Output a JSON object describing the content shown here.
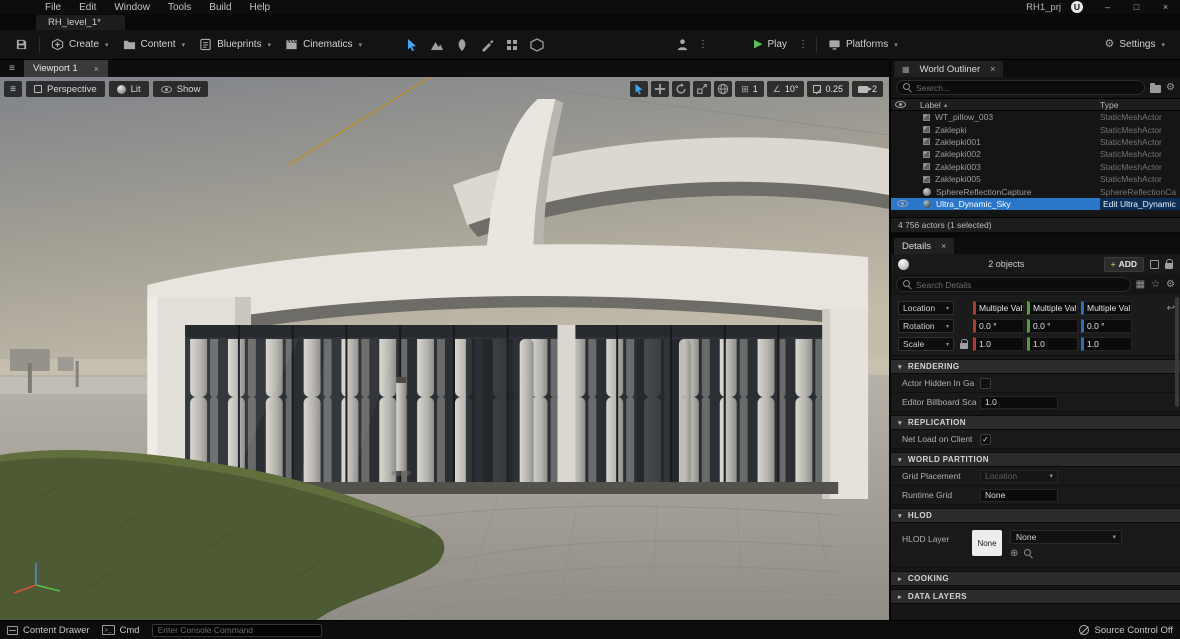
{
  "icons": {
    "menu": "≡",
    "caret_down": "▾",
    "caret_right": "▸",
    "sort_asc": "▴",
    "close": "×",
    "minimize": "–",
    "maximize": "□",
    "gear": "⚙",
    "play": "▶",
    "grid": "⊞",
    "view_grid": "▦",
    "angle": "∠",
    "reset": "↩",
    "check": "✓",
    "circle_plus": "⊕",
    "star": "☆",
    "kebab": "⋮",
    "plus": "+",
    "logo": "U",
    "cmd_prompt": "&gt;_"
  },
  "menubar": {
    "items": [
      "File",
      "Edit",
      "Window",
      "Tools",
      "Build",
      "Help"
    ],
    "project_name": "RH1_prj"
  },
  "tabbar": {
    "level_tab": "RH_level_1*"
  },
  "toolbar": {
    "create": "Create",
    "content": "Content",
    "blueprints": "Blueprints",
    "cinematics": "Cinematics",
    "play": "Play",
    "platforms": "Platforms",
    "settings": "Settings"
  },
  "viewport": {
    "tab": "Viewport 1",
    "perspective": "Perspective",
    "lit": "Lit",
    "show": "Show",
    "grid_snap": "1",
    "rotation_snap": "10°",
    "scale_snap": "0.25",
    "camera_speed": "2"
  },
  "outliner": {
    "title": "World Outliner",
    "search_placeholder": "Search...",
    "col_label": "Label",
    "col_type": "Type",
    "rows": [
      {
        "label": "WT_pillow_003",
        "type": "StaticMeshActor"
      },
      {
        "label": "Zaklepki",
        "type": "StaticMeshActor"
      },
      {
        "label": "Zaklepki001",
        "type": "StaticMeshActor"
      },
      {
        "label": "Zaklepki002",
        "type": "StaticMeshActor"
      },
      {
        "label": "Zaklepki003",
        "type": "StaticMeshActor"
      },
      {
        "label": "Zaklepki005",
        "type": "StaticMeshActor"
      },
      {
        "label": "SphereReflectionCapture",
        "type": "SphereReflectionCa"
      },
      {
        "label": "Ultra_Dynamic_Sky",
        "type": "Edit Ultra_Dynamic"
      }
    ],
    "footer": "4 756 actors (1 selected)"
  },
  "details": {
    "title": "Details",
    "objects_label": "2 objects",
    "add_label": "ADD",
    "search_placeholder": "Search Details",
    "transform": {
      "location_label": "Location",
      "rotation_label": "Rotation",
      "scale_label": "Scale",
      "location_values": [
        "Multiple Val",
        "Multiple Val",
        "Multiple Val"
      ],
      "rotation_values": [
        "0.0 °",
        "0.0 °",
        "0.0 °"
      ],
      "scale_values": [
        "1.0",
        "1.0",
        "1.0"
      ]
    },
    "sections": {
      "rendering": "RENDERING",
      "replication": "REPLICATION",
      "world_partition": "WORLD PARTITION",
      "hlod": "HLOD",
      "cooking": "COOKING",
      "data_layers": "DATA LAYERS"
    },
    "properties": {
      "actor_hidden_label": "Actor Hidden In Ga",
      "billboard_label": "Editor Billboard Sca",
      "billboard_value": "1.0",
      "net_load_label": "Net Load on Client",
      "grid_placement_label": "Grid Placement",
      "grid_placement_value": "Location",
      "runtime_grid_label": "Runtime Grid",
      "runtime_grid_value": "None",
      "hlod_layer_label": "HLOD Layer",
      "hlod_chip": "None",
      "hlod_dropdown_value": "None"
    },
    "axis_colors": {
      "x": "#b03a2e",
      "y": "#52a035",
      "z": "#2f6fba"
    }
  },
  "statusbar": {
    "content_drawer": "Content Drawer",
    "cmd": "Cmd",
    "console_placeholder": "Enter Console Command",
    "source_control": "Source Control Off"
  }
}
